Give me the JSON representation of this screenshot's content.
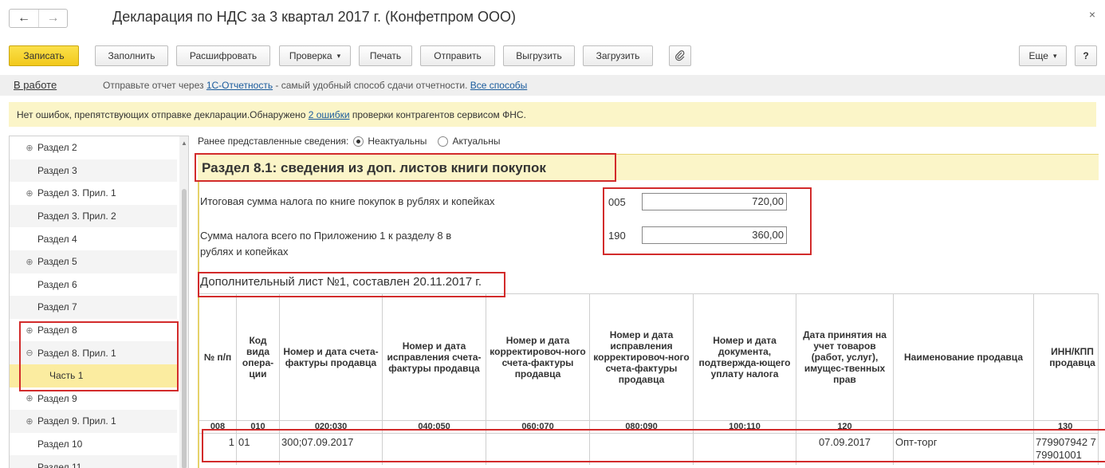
{
  "window": {
    "title": "Декларация по НДС за 3 квартал 2017 г. (Конфетпром ООО)",
    "back_icon": "←",
    "forward_icon": "→",
    "close_icon": "×"
  },
  "toolbar": {
    "save": "Записать",
    "fill": "Заполнить",
    "decode": "Расшифровать",
    "check": "Проверка",
    "print": "Печать",
    "send": "Отправить",
    "export": "Выгрузить",
    "import": "Загрузить",
    "attach_icon": "paperclip-icon",
    "more": "Еще",
    "help": "?",
    "dropdown_arrow": "▾"
  },
  "status": {
    "state": "В работе",
    "hint_prefix": "Отправьте отчет через ",
    "hint_link": "1С-Отчетность",
    "hint_middle": " - самый удобный способ сдачи отчетности. ",
    "hint_all": "Все способы"
  },
  "banner": {
    "prefix": "Нет ошибок, препятствующих отправке декларации.Обнаружено ",
    "link": "2 ошибки",
    "suffix": " проверки контрагентов сервисом ФНС."
  },
  "tree": {
    "items": [
      {
        "label": "Раздел 2",
        "expandable": true
      },
      {
        "label": "Раздел 3",
        "expandable": false
      },
      {
        "label": "Раздел 3. Прил. 1",
        "expandable": true
      },
      {
        "label": "Раздел 3. Прил. 2",
        "expandable": false
      },
      {
        "label": "Раздел 4",
        "expandable": false
      },
      {
        "label": "Раздел 5",
        "expandable": true
      },
      {
        "label": "Раздел 6",
        "expandable": false
      },
      {
        "label": "Раздел 7",
        "expandable": false
      },
      {
        "label": "Раздел 8",
        "expandable": true
      },
      {
        "label": "Раздел 8. Прил. 1",
        "expandable": true,
        "expanded": true
      },
      {
        "label": "Часть 1",
        "expandable": false,
        "child": true,
        "selected": true
      },
      {
        "label": "Раздел 9",
        "expandable": true
      },
      {
        "label": "Раздел 9. Прил. 1",
        "expandable": true
      },
      {
        "label": "Раздел 10",
        "expandable": false
      },
      {
        "label": "Раздел 11",
        "expandable": false
      }
    ]
  },
  "form": {
    "prev_info_label": "Ранее представленные сведения:",
    "option_nonactual": "Неактуальны",
    "option_actual": "Актуальны",
    "selected_option": "Неактуальны",
    "section_title": "Раздел 8.1: сведения из доп. листов книги покупок",
    "total_label": "Итоговая сумма налога по книге покупок в рублях и копейках",
    "total_code": "005",
    "total_value": "720,00",
    "app_label_line1": "Сумма налога всего по Приложению 1 к разделу 8 в",
    "app_label_line2": "рублях и копейках",
    "app_code": "190",
    "app_value": "360,00",
    "additional_sheet": "Дополнительный лист №1, составлен 20.11.2017 г."
  },
  "table": {
    "headers": [
      "№ п/п",
      "Код вида опера-ции",
      "Номер и дата счета-фактуры продавца",
      "Номер и дата исправления счета-фактуры продавца",
      "Номер и дата корректировоч-ного счета-фактуры продавца",
      "Номер и дата исправления корректировоч-ного счета-фактуры продавца",
      "Номер и дата документа, подтвержда-ющего уплату налога",
      "Дата принятия на учет товаров (работ, услуг), имущес-твенных прав",
      "Наименование продавца",
      "ИНН/КПП продавца"
    ],
    "codes": [
      "008",
      "010",
      "020;030",
      "040;050",
      "060;070",
      "080;090",
      "100;110",
      "120",
      "",
      "130"
    ],
    "rows": [
      [
        "1",
        "01",
        "300;07.09.2017",
        "",
        "",
        "",
        "",
        "07.09.2017",
        "Опт-торг",
        "779907942 779901001"
      ]
    ]
  },
  "colors": {
    "accent_yellow": "#f2c91b",
    "banner_bg": "#fbf5c8",
    "highlight_red": "#d22b2b",
    "link_blue": "#1a5b9c"
  }
}
